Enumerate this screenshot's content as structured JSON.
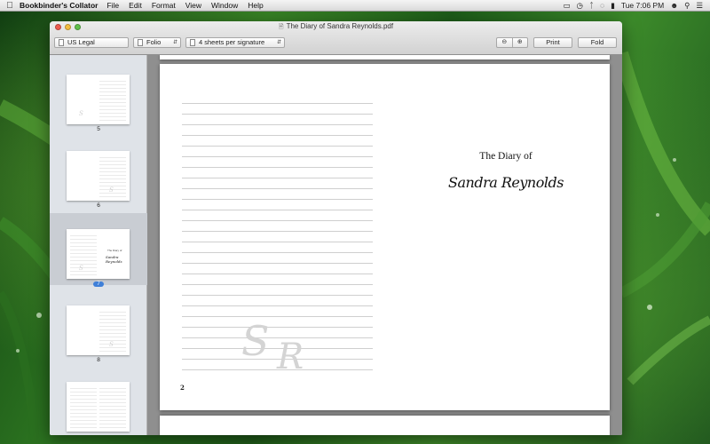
{
  "menubar": {
    "apple": "",
    "app_name": "Bookbinder's Collator",
    "menus": [
      "File",
      "Edit",
      "Format",
      "View",
      "Window",
      "Help"
    ],
    "clock": "Tue 7:06 PM",
    "status_icons": [
      "airplay-icon",
      "time-machine-icon",
      "bluetooth-icon",
      "wifi-icon",
      "battery-icon",
      "user-icon",
      "search-icon",
      "list-icon"
    ]
  },
  "window": {
    "title": "The Diary of Sandra Reynolds.pdf",
    "toolbar": {
      "paper_size": "US Legal",
      "fold": "Folio",
      "signature": "4 sheets per signature",
      "print_label": "Print",
      "fold_label": "Fold"
    }
  },
  "sidebar": {
    "thumbnails": [
      {
        "label": "5",
        "selected": false
      },
      {
        "label": "6",
        "selected": false
      },
      {
        "label": "7",
        "selected": true
      },
      {
        "label": "8",
        "selected": false
      }
    ]
  },
  "page": {
    "number": "2",
    "title": "The Diary of",
    "name": "Sandra Reynolds",
    "monogram_s": "S",
    "monogram_r": "R"
  }
}
